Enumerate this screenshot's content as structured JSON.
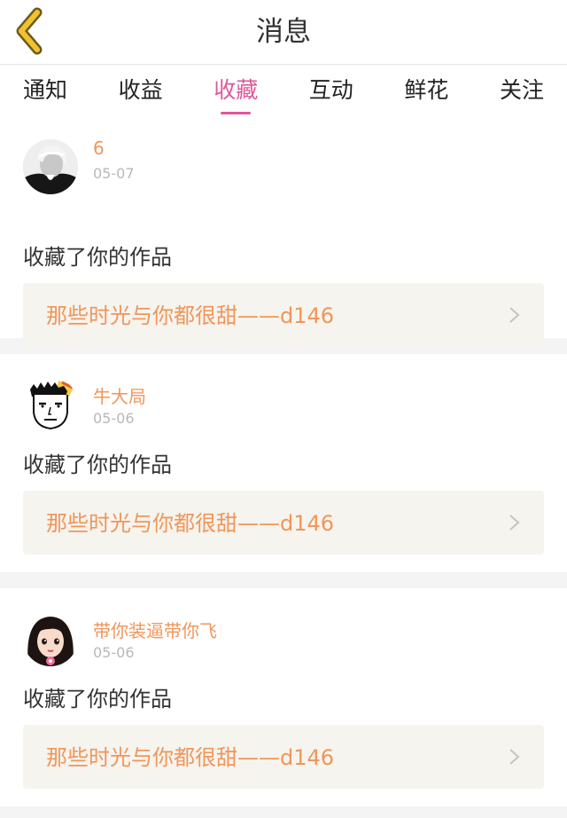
{
  "header": {
    "title": "消息",
    "back_icon": "chevron-left-icon",
    "back_color": "#f2c12e"
  },
  "tabs": [
    {
      "label": "通知",
      "active": false
    },
    {
      "label": "收益",
      "active": false
    },
    {
      "label": "收藏",
      "active": true
    },
    {
      "label": "互动",
      "active": false
    },
    {
      "label": "鲜花",
      "active": false
    },
    {
      "label": "关注",
      "active": false
    }
  ],
  "colors": {
    "accent": "#e0579b",
    "username": "#f0965a",
    "work_title": "#f0965a",
    "work_bg": "#f5f4ee"
  },
  "items": [
    {
      "user": "6",
      "date": "05-07",
      "action": "收藏了你的作品",
      "work_title": "那些时光与你都很甜——d146",
      "avatar_icon": "avatar-photo"
    },
    {
      "user": "牛大局",
      "date": "05-06",
      "action": "收藏了你的作品",
      "work_title": "那些时光与你都很甜——d146",
      "avatar_icon": "avatar-cartoon-face"
    },
    {
      "user": "带你装逼带你飞",
      "date": "05-06",
      "action": "收藏了你的作品",
      "work_title": "那些时光与你都很甜——d146",
      "avatar_icon": "avatar-girl"
    }
  ]
}
